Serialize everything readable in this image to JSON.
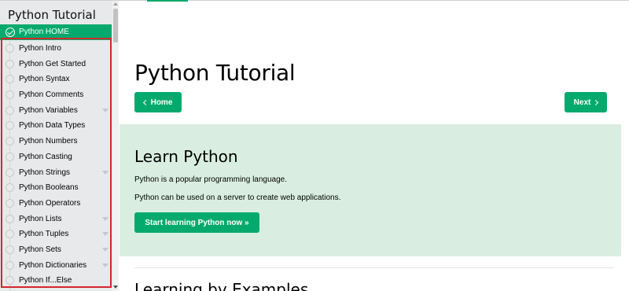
{
  "sidebar": {
    "title": "Python Tutorial",
    "active_item": "Python HOME",
    "items": [
      {
        "label": "Python Intro",
        "expandable": false
      },
      {
        "label": "Python Get Started",
        "expandable": false
      },
      {
        "label": "Python Syntax",
        "expandable": false
      },
      {
        "label": "Python Comments",
        "expandable": false
      },
      {
        "label": "Python Variables",
        "expandable": true
      },
      {
        "label": "Python Data Types",
        "expandable": false
      },
      {
        "label": "Python Numbers",
        "expandable": false
      },
      {
        "label": "Python Casting",
        "expandable": false
      },
      {
        "label": "Python Strings",
        "expandable": true
      },
      {
        "label": "Python Booleans",
        "expandable": false
      },
      {
        "label": "Python Operators",
        "expandable": false
      },
      {
        "label": "Python Lists",
        "expandable": true
      },
      {
        "label": "Python Tuples",
        "expandable": true
      },
      {
        "label": "Python Sets",
        "expandable": true
      },
      {
        "label": "Python Dictionaries",
        "expandable": true
      },
      {
        "label": "Python If...Else",
        "expandable": false
      }
    ]
  },
  "main": {
    "title": "Python Tutorial",
    "home_button": "Home",
    "next_button": "Next",
    "learn": {
      "heading": "Learn Python",
      "p1": "Python is a popular programming language.",
      "p2": "Python can be used on a server to create web applications.",
      "start_button": "Start learning Python now »"
    },
    "examples_heading": "Learning by Examples"
  },
  "colors": {
    "accent": "#04AA6D",
    "sidebar_bg": "#E7E9EB",
    "panel_bg": "#D9EEE1",
    "highlight_border": "#d6262f"
  },
  "icons": {
    "active_item_icon": "check-circle-icon",
    "item_icon": "circle-icon",
    "expand_icon": "chevron-down-icon",
    "home_icon": "chevron-left-icon",
    "next_icon": "chevron-right-icon"
  }
}
